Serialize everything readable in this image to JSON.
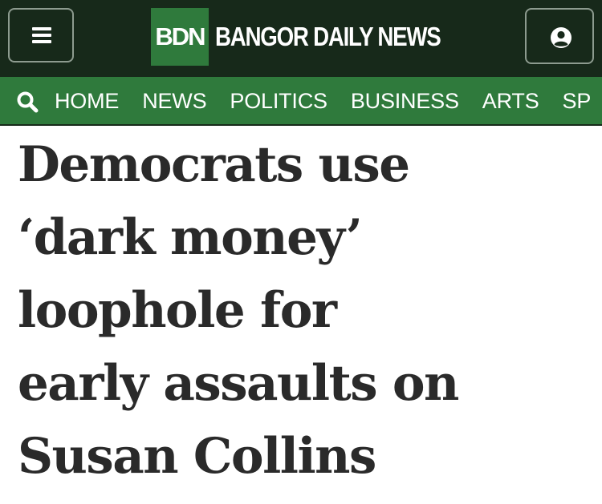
{
  "header": {
    "logo_abbr": "BDN",
    "logo_name": "BANGOR DAILY NEWS",
    "menu_icon": "hamburger-menu-icon",
    "account_icon": "user-account-icon",
    "background_color": "#17291a",
    "accent_color": "#2f7a3c"
  },
  "nav": {
    "search_icon": "search-icon",
    "items": [
      {
        "label": "HOME"
      },
      {
        "label": "NEWS"
      },
      {
        "label": "POLITICS"
      },
      {
        "label": "BUSINESS"
      },
      {
        "label": "ARTS"
      },
      {
        "label": "SP"
      }
    ]
  },
  "article": {
    "headline_lines": [
      "Democrats use",
      "‘dark money’",
      "loophole for",
      "early assaults on",
      "Susan Collins"
    ]
  }
}
